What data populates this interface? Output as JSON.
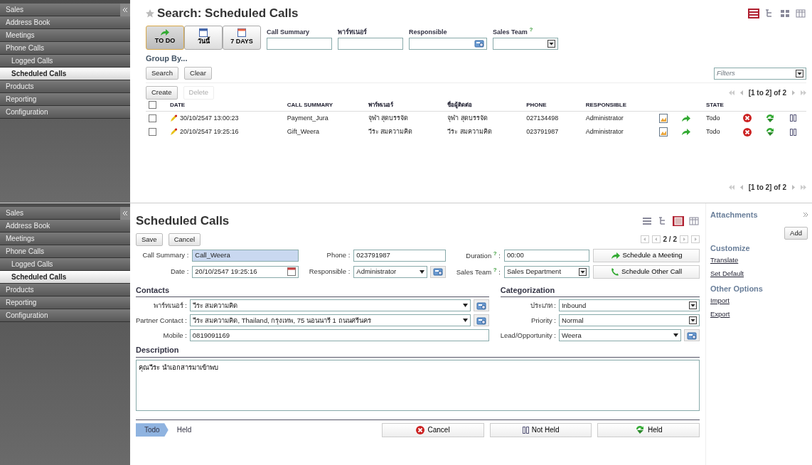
{
  "list_screen": {
    "sidebar": {
      "items": [
        {
          "label": "Sales",
          "selected": false
        },
        {
          "label": "Address Book",
          "selected": false
        },
        {
          "label": "Meetings",
          "selected": false
        },
        {
          "label": "Phone Calls",
          "selected": false,
          "children": [
            {
              "label": "Logged Calls",
              "selected": false
            },
            {
              "label": "Scheduled Calls",
              "selected": true
            }
          ]
        },
        {
          "label": "Products",
          "selected": false
        },
        {
          "label": "Reporting",
          "selected": false
        },
        {
          "label": "Configuration",
          "selected": false
        }
      ]
    },
    "title": "Search: Scheduled Calls",
    "view_modes": [
      {
        "kind": "list",
        "selected": true
      },
      {
        "kind": "tree",
        "selected": false
      },
      {
        "kind": "grid",
        "selected": false
      },
      {
        "kind": "calendar",
        "selected": false
      }
    ],
    "filter_buttons": [
      {
        "label": "TO DO",
        "kind": "arrow",
        "selected": true
      },
      {
        "label": "วันนี้",
        "kind": "day",
        "selected": false
      },
      {
        "label": "7 DAYS",
        "kind": "week",
        "selected": false
      }
    ],
    "search_fields": [
      {
        "label": "Call Summary",
        "kind": "text"
      },
      {
        "label": "พาร์ทเนอร์",
        "kind": "text"
      },
      {
        "label": "Responsible",
        "kind": "lookup"
      },
      {
        "label": "Sales Team",
        "kind": "select",
        "help": "?"
      }
    ],
    "group_by": "Group By...",
    "search_buttons": [
      "Search",
      "Clear"
    ],
    "filters": {
      "placeholder": "Filters"
    },
    "actions": [
      {
        "label": "Create",
        "disabled": false
      },
      {
        "label": "Delete",
        "disabled": true
      }
    ],
    "pager": "[1 to 2] of 2",
    "table": {
      "all_checked": false,
      "columns": [
        "DATE",
        "CALL SUMMARY",
        "พาร์ทเนอร์",
        "ชื่อผู้ติดต่อ",
        "PHONE",
        "RESPONSIBLE",
        "STATE"
      ],
      "rows": [
        {
          "checked": false,
          "date": "30/10/2547 13:00:23",
          "summary": "Payment_Jura",
          "partner": "จุฬา สุดบรรจัด",
          "contact": "จุฬา สุดบรรจัด",
          "phone": "027134498",
          "responsible": "Administrator",
          "state": "Todo"
        },
        {
          "checked": false,
          "date": "20/10/2547 19:25:16",
          "summary": "Gift_Weera",
          "partner": "วีระ สมความคิด",
          "contact": "วีระ สมความคิด",
          "phone": "023791987",
          "responsible": "Administrator",
          "state": "Todo"
        }
      ]
    },
    "pager_bottom": "[1 to 2] of 2"
  },
  "form_screen": {
    "sidebar": {
      "items": [
        {
          "label": "Sales",
          "selected": false
        },
        {
          "label": "Address Book",
          "selected": false
        },
        {
          "label": "Meetings",
          "selected": false
        },
        {
          "label": "Phone Calls",
          "selected": false,
          "children": [
            {
              "label": "Logged Calls",
              "selected": false
            },
            {
              "label": "Scheduled Calls",
              "selected": true
            }
          ]
        },
        {
          "label": "Products",
          "selected": false
        },
        {
          "label": "Reporting",
          "selected": false
        },
        {
          "label": "Configuration",
          "selected": false
        }
      ]
    },
    "title": "Scheduled Calls",
    "view_modes": [
      {
        "kind": "list",
        "selected": false
      },
      {
        "kind": "tree",
        "selected": false
      },
      {
        "kind": "form",
        "selected": true
      },
      {
        "kind": "calendar",
        "selected": false
      }
    ],
    "buttons": [
      "Save",
      "Cancel"
    ],
    "record_pager": "2 / 2",
    "header_fields": [
      {
        "label": "Call Summary",
        "sep": ":",
        "value": "Call_Weera",
        "kind": "text",
        "required": true
      },
      {
        "label": "Phone",
        "sep": ":",
        "value": "023791987",
        "kind": "text",
        "required": false
      },
      {
        "label": "Duration",
        "help": "?",
        "sep": ":",
        "value": "00:00",
        "kind": "text",
        "required": false
      },
      {
        "label": "Date",
        "sep": ":",
        "value": "20/10/2547 19:25:16",
        "kind": "date",
        "required": false
      },
      {
        "label": "Responsible",
        "sep": ":",
        "value": "Administrator",
        "kind": "many2one",
        "required": false
      },
      {
        "label": "Sales Team",
        "help": "?",
        "sep": ":",
        "value": "Sales Department",
        "kind": "select",
        "required": false
      }
    ],
    "header_buttons": [
      {
        "label": "Schedule a Meeting",
        "kind": "meeting"
      },
      {
        "label": "Schedule Other Call",
        "kind": "call"
      }
    ],
    "contacts": {
      "title": "Contacts",
      "fields": [
        {
          "label": "พาร์ทเนอร์",
          "sep": ":",
          "value": "วีระ สมความคิด",
          "kind": "many2one"
        },
        {
          "label": "Partner Contact",
          "sep": ":",
          "value": "วีระ สมความคิด, Thailand, กรุงเทพ, 75 นอนนารี 1 ถนนศรีนคร",
          "kind": "many2one"
        },
        {
          "label": "Mobile",
          "sep": ":",
          "value": "0819091169",
          "kind": "text"
        }
      ]
    },
    "categorization": {
      "title": "Categorization",
      "fields": [
        {
          "label": "ประเภท",
          "sep": ":",
          "value": "Inbound",
          "kind": "select"
        },
        {
          "label": "Priority",
          "sep": ":",
          "value": "Normal",
          "kind": "select"
        },
        {
          "label": "Lead/Opportunity",
          "sep": ":",
          "value": "Weera",
          "kind": "many2one"
        }
      ]
    },
    "description": {
      "title": "Description",
      "value": "คุณวีระ นำเอกสารมาเข้าพบ"
    },
    "stages": [
      {
        "label": "Todo",
        "selected": true
      },
      {
        "label": "Held",
        "selected": false
      }
    ],
    "state_buttons": [
      {
        "label": "Cancel",
        "kind": "cancel"
      },
      {
        "label": "Not Held",
        "kind": "pause"
      },
      {
        "label": "Held",
        "kind": "held"
      }
    ],
    "side_panel": {
      "attachments": "Attachments",
      "add": "Add",
      "sections": [
        {
          "title": "Customize",
          "items": [
            "Translate",
            "Set Default"
          ]
        },
        {
          "title": "Other Options",
          "items": [
            "Import",
            "Export"
          ]
        }
      ]
    }
  }
}
